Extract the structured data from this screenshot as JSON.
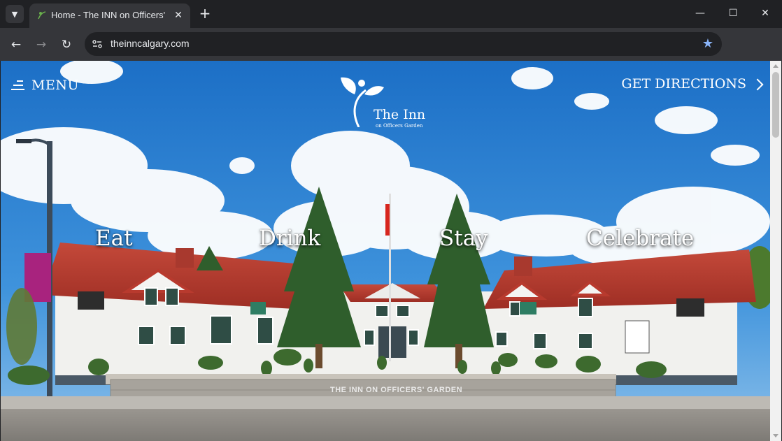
{
  "browser": {
    "tab_title": "Home - The INN on Officers' Garden",
    "url": "theinncalgary.com",
    "icons": [
      "tab-search-icon",
      "close-icon",
      "plus-icon",
      "minimize-icon",
      "maximize-icon",
      "window-close-icon",
      "back-icon",
      "forward-icon",
      "reload-icon",
      "site-settings-icon",
      "bookmark-star-icon",
      "extension-icon",
      "more-menu-icon"
    ]
  },
  "header": {
    "menu_label": "MENU",
    "directions_label": "GET DIRECTIONS",
    "logo_name": "The Inn",
    "logo_sub": "on Officers Garden"
  },
  "nav": {
    "items": [
      "Eat",
      "Drink",
      "Stay",
      "Celebrate"
    ]
  },
  "scene": {
    "garden_sign": "THE INN ON OFFICERS' GARDEN"
  },
  "colors": {
    "chrome_dark": "#202124",
    "chrome_toolbar": "#35363a",
    "sky": "#2a7fd0",
    "roof": "#b83a2e",
    "accent_link": "#8ab4f8"
  }
}
